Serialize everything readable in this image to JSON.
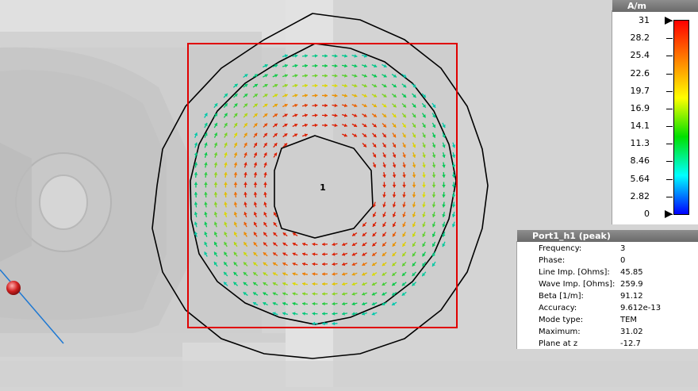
{
  "legend": {
    "unit": "A/m",
    "ticks": [
      "31",
      "28.2",
      "25.4",
      "22.6",
      "19.7",
      "16.9",
      "14.1",
      "11.3",
      "8.46",
      "5.64",
      "2.82",
      "0"
    ],
    "gradient_colors": [
      "#ff0000",
      "#ff8000",
      "#ffff00",
      "#00e000",
      "#00ffff",
      "#0000ff"
    ]
  },
  "info": {
    "title": "Port1_h1 (peak)",
    "rows": [
      {
        "key": "Frequency:",
        "value": "3"
      },
      {
        "key": "Phase:",
        "value": "0"
      },
      {
        "key": "Line Imp. [Ohms]:",
        "value": "45.85"
      },
      {
        "key": "Wave Imp. [Ohms]:",
        "value": "259.9"
      },
      {
        "key": "Beta [1/m]:",
        "value": "91.12"
      },
      {
        "key": "Accuracy:",
        "value": "9.612e-13"
      },
      {
        "key": "Mode type:",
        "value": "TEM"
      },
      {
        "key": "Maximum:",
        "value": "31.02"
      },
      {
        "key": "Plane at z",
        "value": "-12.7"
      }
    ]
  },
  "port": {
    "label": "1"
  },
  "colors": {
    "port_frame": "#e00000",
    "outline": "#000000",
    "axis_line": "#1e78d2",
    "marker": "#d02020"
  }
}
